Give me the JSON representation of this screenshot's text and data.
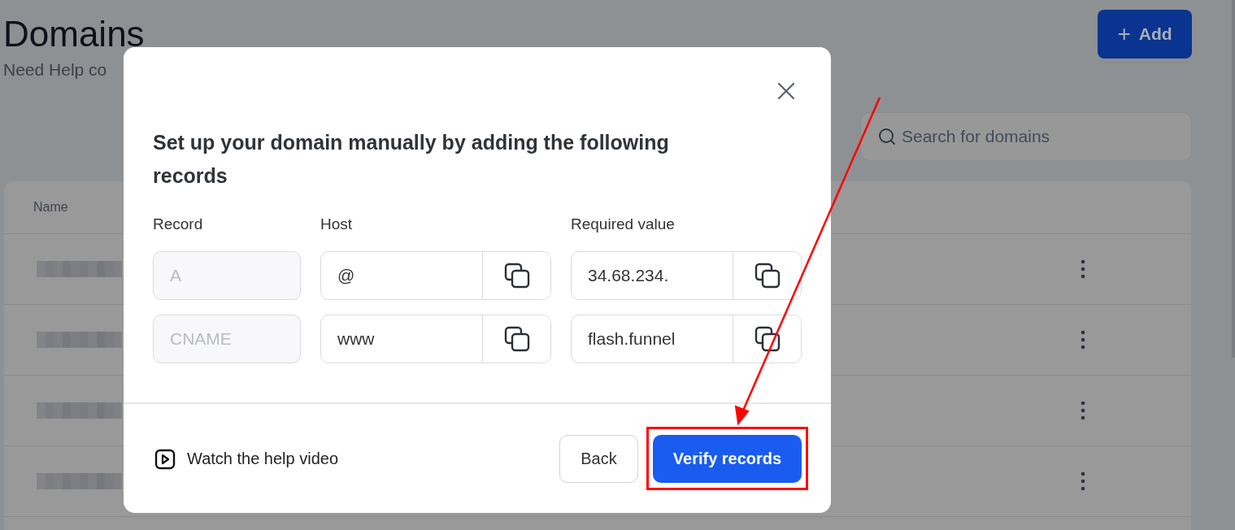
{
  "page": {
    "title": "Domains",
    "subtitle": "Need Help co",
    "add_button": {
      "icon": "+",
      "label": "Add"
    },
    "search": {
      "placeholder": "Search for domains"
    }
  },
  "table": {
    "columns": [
      "Name"
    ],
    "rows": [
      {
        "redacted": true
      },
      {
        "redacted": true
      },
      {
        "redacted": true
      },
      {
        "redacted": true
      }
    ]
  },
  "modal": {
    "title": "Set up your domain manually by adding the following records",
    "columns": [
      "Record",
      "Host",
      "Required value"
    ],
    "records": [
      {
        "record": "A",
        "record_disabled": true,
        "host": "@",
        "value": "34.68.234."
      },
      {
        "record": "CNAME",
        "record_disabled": true,
        "host": "www",
        "value": "flash.funnel"
      }
    ],
    "help_link": "Watch the help video",
    "buttons": [
      {
        "label": "Back",
        "kind": "secondary"
      },
      {
        "label": "Verify records",
        "kind": "primary"
      }
    ]
  },
  "annotation": {
    "highlight": true
  }
}
